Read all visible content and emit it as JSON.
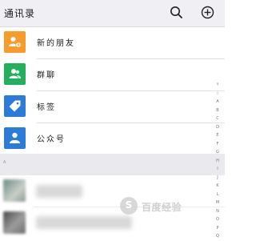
{
  "header": {
    "title": "通讯录",
    "search_icon": "search-icon",
    "add_icon": "add-circle-icon"
  },
  "menu": [
    {
      "label": "新的朋友",
      "icon": "add-friend-icon",
      "color": "#f79c2b"
    },
    {
      "label": "群聊",
      "icon": "group-chat-icon",
      "color": "#22b05d"
    },
    {
      "label": "标签",
      "icon": "tag-icon",
      "color": "#2b7bd8"
    },
    {
      "label": "公众号",
      "icon": "official-account-icon",
      "color": "#2b7bd8"
    }
  ],
  "section": {
    "letter": "A"
  },
  "index_letters": [
    "↑",
    "☆",
    "A",
    "B",
    "C",
    "D",
    "E",
    "F",
    "G",
    "H",
    "I",
    "J",
    "K",
    "L",
    "M",
    "N",
    "O",
    "P",
    "Q"
  ],
  "watermark": {
    "logo": "S",
    "text": "百度经验"
  },
  "colors": {
    "header_bg": "#efeff4",
    "section_bg": "#e9e9ee"
  }
}
